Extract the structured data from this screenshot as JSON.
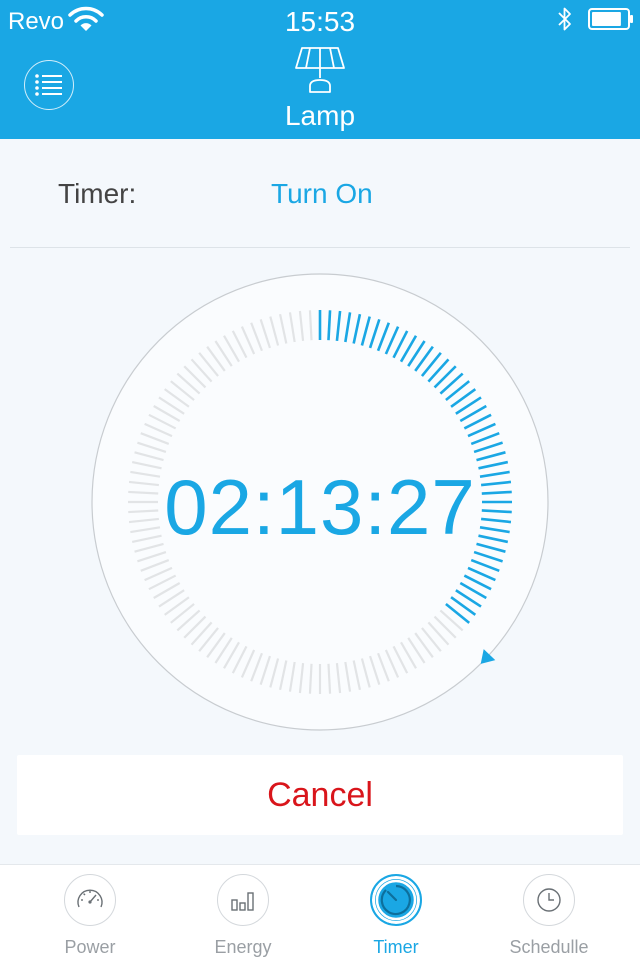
{
  "status_bar": {
    "carrier": "Revo",
    "time": "15:53",
    "icons": [
      "wifi-icon",
      "bluetooth-icon",
      "battery-icon"
    ],
    "battery_level": 0.85
  },
  "header": {
    "title": "Lamp",
    "device_icon": "lamp-icon",
    "menu_icon": "list-menu-icon"
  },
  "timer": {
    "label": "Timer:",
    "mode": "Turn On",
    "remaining": "02:13:27",
    "progress": 0.37,
    "tick_count": 120
  },
  "actions": {
    "cancel_label": "Cancel"
  },
  "tabs": [
    {
      "label": "Power",
      "icon": "speedometer-icon",
      "active": false
    },
    {
      "label": "Energy",
      "icon": "bar-chart-icon",
      "active": false
    },
    {
      "label": "Timer",
      "icon": "timer-icon",
      "active": true
    },
    {
      "label": "Schedulle",
      "icon": "clock-icon",
      "active": false
    }
  ],
  "colors": {
    "accent": "#1aa7e4",
    "danger": "#d9151b",
    "tick_inactive": "#e2e4e6",
    "background": "#f4f8fc"
  }
}
